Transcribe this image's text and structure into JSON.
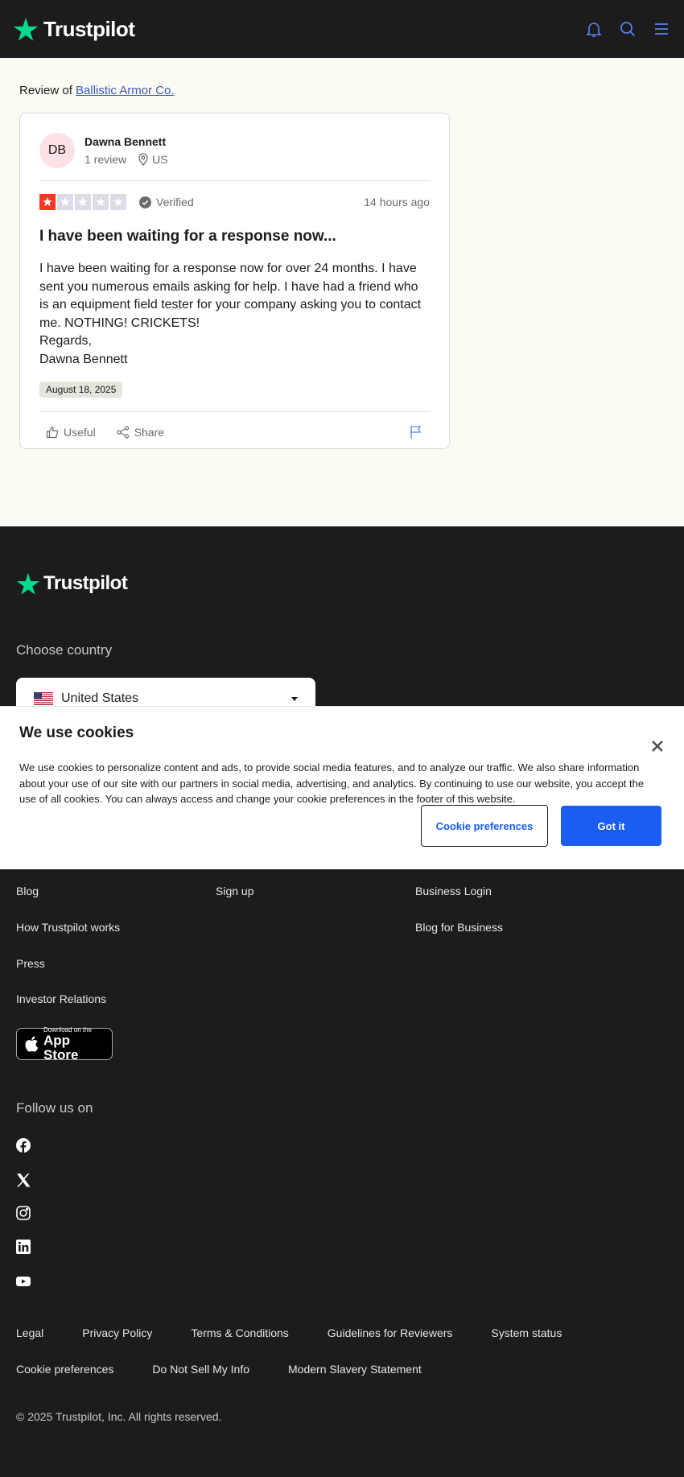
{
  "header": {
    "logo_text": "Trustpilot"
  },
  "review": {
    "review_of_prefix": "Review of ",
    "company": "Ballistic Armor Co.",
    "reviewer": {
      "initials": "DB",
      "name": "Dawna Bennett",
      "review_count": "1 review",
      "country": "US"
    },
    "rating": 1,
    "rating_max": 5,
    "verified": "Verified",
    "time_ago": "14 hours ago",
    "title": "I have been waiting for a response now...",
    "body": "I have been waiting for a response now for over 24 months. I have sent you numerous emails asking for help. I have had a friend who is an equipment field tester for your company asking you to contact me. NOTHING! CRICKETS!\nRegards,\nDawna Bennett",
    "experience_date": "August 18, 2025",
    "useful_label": "Useful",
    "share_label": "Share"
  },
  "footer": {
    "logo_text": "Trustpilot",
    "choose_country": "Choose country",
    "country": "United States",
    "col1": [
      "Blog",
      "How Trustpilot works",
      "Press",
      "Investor Relations"
    ],
    "col2": [
      "Sign up"
    ],
    "col3": [
      "Business Login",
      "Blog for Business"
    ],
    "appstore_small": "Download on the",
    "appstore_big": "App Store",
    "follow_us": "Follow us on",
    "legal_row1": [
      "Legal",
      "Privacy Policy",
      "Terms & Conditions",
      "Guidelines for Reviewers",
      "System status"
    ],
    "legal_row2": [
      "Cookie preferences",
      "Do Not Sell My Info",
      "Modern Slavery Statement"
    ],
    "copyright": "© 2025 Trustpilot, Inc. All rights reserved."
  },
  "cookie": {
    "title": "We use cookies",
    "text": "We use cookies to personalize content and ads, to provide social media features, and to analyze our traffic. We also share information about your use of our site with our partners in social media, advertising, and analytics. By continuing to use our website, you accept the use of all cookies. You can always access and change your cookie preferences in the footer of this website.",
    "pref_button": "Cookie preferences",
    "got_it_button": "Got it"
  },
  "colors": {
    "brand_green": "#04da8d",
    "star_red": "#ff3722",
    "link_blue": "#3c57bc",
    "button_blue": "#195ef0",
    "dark_bg": "#1c1c1c"
  }
}
